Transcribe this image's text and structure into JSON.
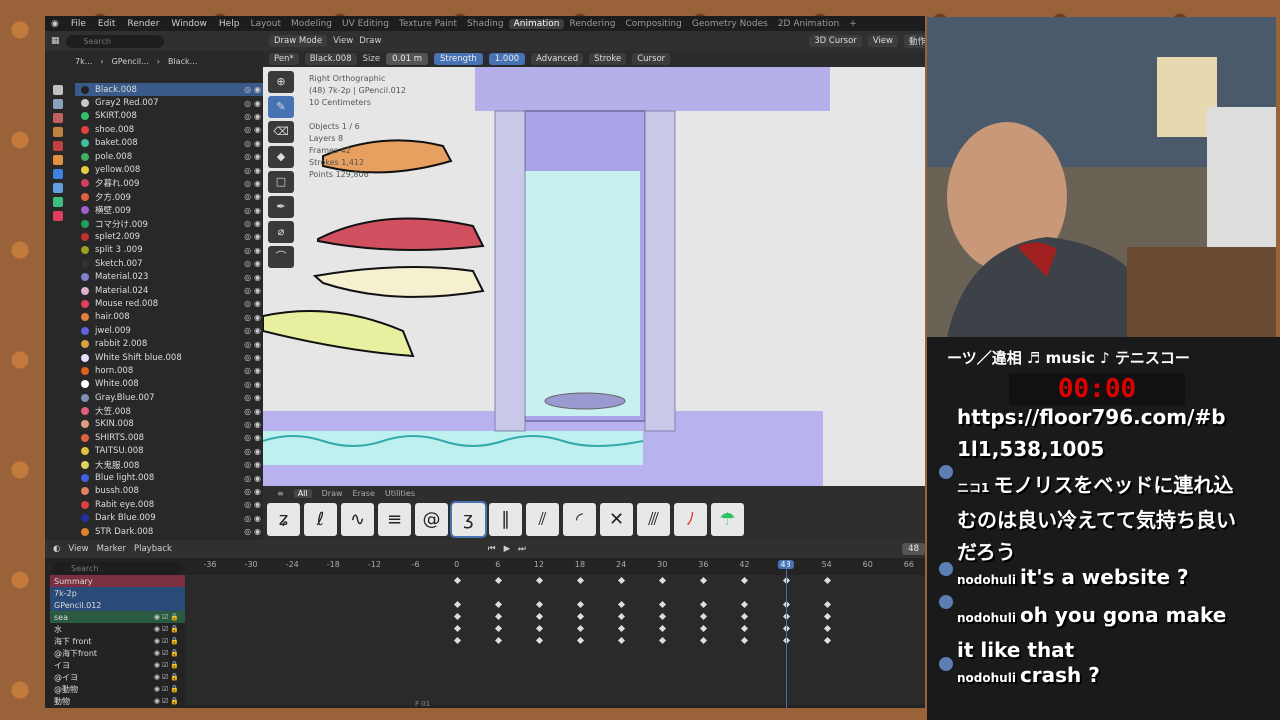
{
  "topbar": {
    "menus": [
      "File",
      "Edit",
      "Render",
      "Window",
      "Help"
    ],
    "workspaces": [
      "Layout",
      "Modeling",
      "UV Editing",
      "Texture Paint",
      "Shading",
      "Animation",
      "Rendering",
      "Compositing",
      "Geometry Nodes",
      "2D Animation"
    ],
    "active_workspace": "Animation",
    "plus": "+"
  },
  "outliner": {
    "search_placeholder": "Search",
    "breadcrumb": [
      "7k...",
      "GPencil...",
      "Black..."
    ],
    "materials": [
      {
        "name": "Black.008",
        "color": "#222222",
        "selected": true
      },
      {
        "name": "Gray2 Red.007",
        "color": "#c8c8c8"
      },
      {
        "name": "SKIRT.008",
        "color": "#30c070"
      },
      {
        "name": "shoe.008",
        "color": "#e04040"
      },
      {
        "name": "baket.008",
        "color": "#40c0a0"
      },
      {
        "name": "pole.008",
        "color": "#40b060"
      },
      {
        "name": "yellow.008",
        "color": "#e0d040"
      },
      {
        "name": "夕暮れ.009",
        "color": "#d04060"
      },
      {
        "name": "夕方.009",
        "color": "#e06040"
      },
      {
        "name": "横壁.009",
        "color": "#a060d0"
      },
      {
        "name": "コマ分け.009",
        "color": "#20a060"
      },
      {
        "name": "splet2.009",
        "color": "#c03030"
      },
      {
        "name": "split 3 .009",
        "color": "#a0a020"
      },
      {
        "name": "Sketch.007",
        "color": "#333333"
      },
      {
        "name": "Material.023",
        "color": "#8080d0"
      },
      {
        "name": "Material.024",
        "color": "#e0b0d0"
      },
      {
        "name": "Mouse red.008",
        "color": "#e04060"
      },
      {
        "name": "hair.008",
        "color": "#e08040"
      },
      {
        "name": "jwel.009",
        "color": "#6060e0"
      },
      {
        "name": "rabbit 2.008",
        "color": "#e0a040"
      },
      {
        "name": "White Shift blue.008",
        "color": "#e0e0ff"
      },
      {
        "name": "horn.008",
        "color": "#e06020"
      },
      {
        "name": "White.008",
        "color": "#ffffff"
      },
      {
        "name": "Gray.Blue.007",
        "color": "#8090b0"
      },
      {
        "name": "大笠.008",
        "color": "#e06080"
      },
      {
        "name": "SKIN.008",
        "color": "#e0a080"
      },
      {
        "name": "SHIRTS.008",
        "color": "#e06040"
      },
      {
        "name": "TAITSU.008",
        "color": "#e0c040"
      },
      {
        "name": "大鬼服.008",
        "color": "#e0d060"
      },
      {
        "name": "Blue light.008",
        "color": "#4060e0"
      },
      {
        "name": "bussh.008",
        "color": "#e08060"
      },
      {
        "name": "Rabit eye.008",
        "color": "#e04040"
      },
      {
        "name": "Dark Blue.009",
        "color": "#2030a0"
      },
      {
        "name": "STR Dark.008",
        "color": "#e08030"
      }
    ]
  },
  "viewport": {
    "mode": "Draw Mode",
    "view": "View",
    "draw": "Draw",
    "cursor3d": "3D Cursor",
    "view_menu": "View",
    "action": "動作",
    "pen": "Pen*",
    "material": "Black.008",
    "size_label": "Size",
    "size_value": "0.01 m",
    "strength_label": "Strength",
    "strength_value": "1.000",
    "advanced": "Advanced",
    "stroke": "Stroke",
    "cursor": "Cursor",
    "info": [
      "Right Orthographic",
      "(48) 7k-2p | GPencil.012",
      "10 Centimeters",
      "",
      "Objects   1 / 6",
      "Layers   8",
      "Frames   42",
      "Strokes   1,412",
      "Points   129,806"
    ]
  },
  "shelf": {
    "tabs": [
      "All",
      "Draw",
      "Erase",
      "Utilities"
    ],
    "active_tab": "All"
  },
  "timeline": {
    "view": "View",
    "marker": "Marker",
    "playback": "Playback",
    "search_placeholder": "Search",
    "current_frame": "48",
    "frame_label": "F 01",
    "ticks": [
      "-36",
      "-30",
      "-24",
      "-18",
      "-12",
      "-6",
      "0",
      "6",
      "12",
      "18",
      "24",
      "30",
      "36",
      "42",
      "48",
      "54",
      "60",
      "66"
    ],
    "channels": [
      "Summary",
      "7k-2p",
      "GPencil.012",
      "sea",
      "水",
      "海下  front",
      "@海下front",
      "イヨ",
      "@イヨ",
      "@動物",
      "動物"
    ]
  },
  "stream": {
    "ticker": "ーツ／違相          ♬ music ♪ テニスコー",
    "timer": "00:00",
    "url": "https://floor796.com/#b",
    "coords": "1l1,538,1005",
    "messages": [
      {
        "user": "ニコ1",
        "text": "モノリスをベッドに連れ込むのは良い冷えてて気持ち良いだろう"
      },
      {
        "user": "nodohuli",
        "text": "it's a website ?"
      },
      {
        "user": "nodohuli",
        "text": "oh you gona make it like that"
      },
      {
        "user": "nodohuli",
        "text": "crash ?"
      }
    ]
  }
}
